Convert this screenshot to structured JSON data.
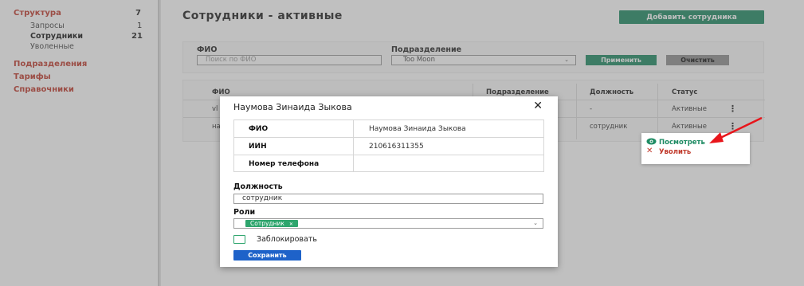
{
  "sidebar": {
    "items": [
      {
        "label": "Структура",
        "count": "7"
      },
      {
        "label": "Подразделения"
      },
      {
        "label": "Тарифы"
      },
      {
        "label": "Справочники"
      }
    ],
    "sub_items": [
      {
        "label": "Запросы",
        "count": "1"
      },
      {
        "label": "Сотрудники",
        "count": "21"
      },
      {
        "label": "Уволенные"
      }
    ]
  },
  "header": {
    "title": "Сотрудники - активные",
    "add_button": "Добавить сотрудника"
  },
  "filters": {
    "fio_label": "ФИО",
    "fio_placeholder": "Поиск по ФИО",
    "division_label": "Подразделение",
    "division_value": "Too Moon",
    "apply_button": "Применить",
    "clear_button": "Очистить"
  },
  "table": {
    "columns": [
      "ФИО",
      "Подразделение",
      "Должность",
      "Статус"
    ],
    "rows": [
      {
        "fio": "vl",
        "position": "-",
        "status": "Активные"
      },
      {
        "fio": "на",
        "position": "сотрудник",
        "status": "Активные"
      }
    ]
  },
  "context_menu": {
    "view": "Посмотреть",
    "fire": "Уволить"
  },
  "modal": {
    "title": "Наумова Зинаида Зыкова",
    "info": [
      {
        "label": "ФИО",
        "value": "Наумова Зинаида Зыкова"
      },
      {
        "label": "ИИН",
        "value": "210616311355"
      },
      {
        "label": "Номер телефона",
        "value": ""
      }
    ],
    "position_label": "Должность",
    "position_value": "сотрудник",
    "roles_label": "Роли",
    "role_chip": "Сотрудник",
    "block_label": "Заблокировать",
    "save_button": "Сохранить"
  },
  "colors": {
    "accent_green": "#1e8b63",
    "danger_red": "#c0392b",
    "primary_blue": "#1e62c9"
  }
}
